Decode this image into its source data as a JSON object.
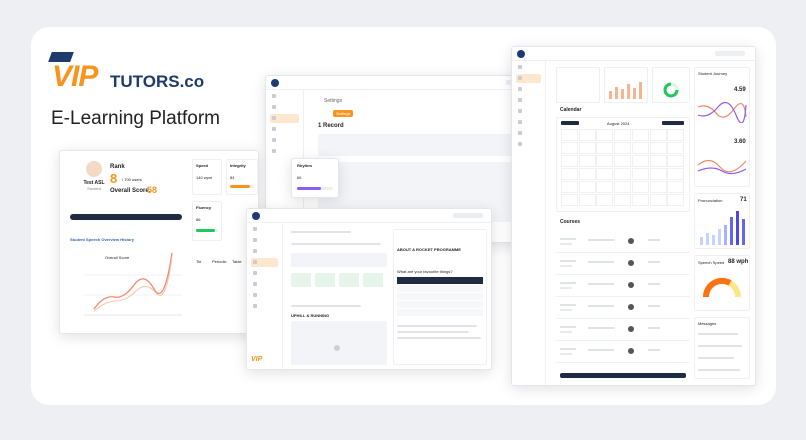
{
  "brand": {
    "name_prefix": "VIP",
    "name_suffix": "TUTORS.co",
    "tagline": "E-Learning Platform"
  },
  "colors": {
    "accent": "#f7941d",
    "navy": "#1f3a6d",
    "coral": "#f08a6a",
    "purple": "#8b5cf6",
    "green": "#22c55e"
  },
  "screen_left": {
    "student_name": "Test ASL",
    "student_role": "Student",
    "rank_label": "Rank",
    "rank_value": "8",
    "rank_total": "/ 700 users",
    "overall_label": "Overall Score:",
    "overall_value": "58",
    "speed_label": "Speed",
    "speed_value": "140 wpm",
    "integrity_label": "Integrity",
    "integrity_value": "84",
    "rhythm_label": "Rhythm",
    "rhythm_value": "66",
    "fluency_label": "Fluency",
    "fluency_value": "86",
    "chart_title": "Student Speech Overview History",
    "chart_legend": "Overall Score",
    "cols": [
      "Tie",
      "Periodic",
      "Table"
    ]
  },
  "screen_top": {
    "title": "Settings",
    "section": "1 Record",
    "tab": "Settings"
  },
  "screen_right": {
    "student_journey": "Student Journey",
    "rating_value": "4.59",
    "rating2_value": "3.60",
    "pronunciation_label": "Pronunciation",
    "pronunciation_value": "71",
    "speed_label": "Speech Speed",
    "speed_value": "88 wph",
    "messages_label": "Messages",
    "calendar_label": "Calendar",
    "month_label": "August 2024",
    "courses_label": "Courses"
  },
  "screen_front": {
    "heading": "ABOUT A ROCKET PROGRAMME",
    "question": "What are your favourite things?",
    "footer_title": "UPHILL & RUNNING"
  }
}
